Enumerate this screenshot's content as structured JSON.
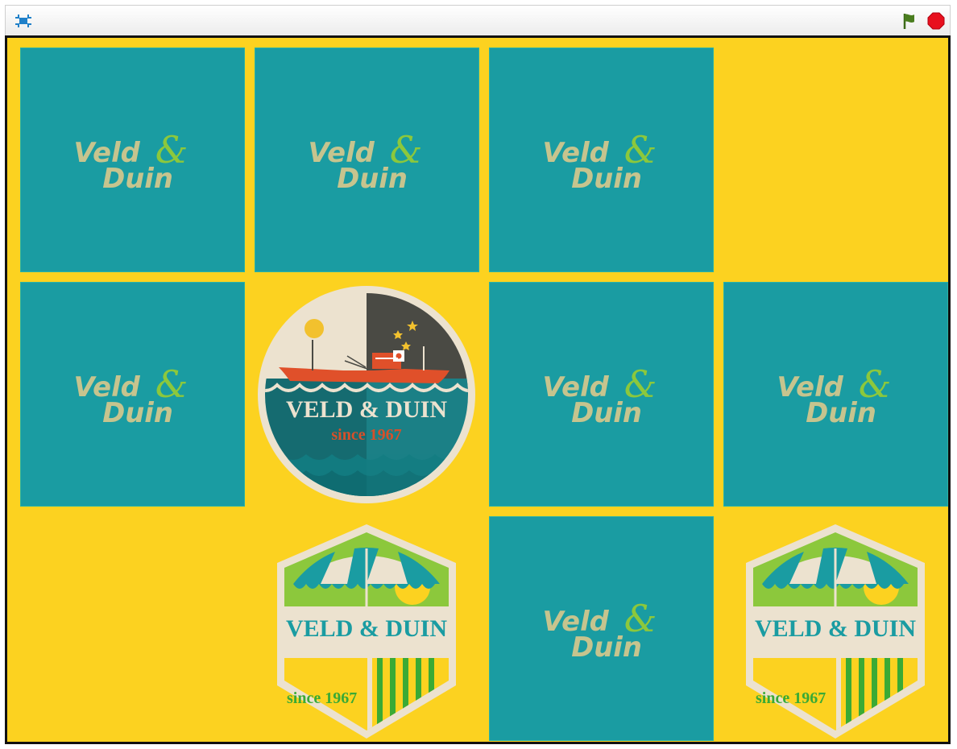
{
  "toolbar": {
    "fullscreen_icon": "fullscreen-toggle-icon",
    "green_flag_icon": "green-flag-icon",
    "stop_icon": "stop-sign-icon"
  },
  "colors": {
    "stage_bg": "#fcd220",
    "card_back": "#1a9ca2",
    "logo_text": "#c6c48e",
    "logo_amp": "#8cc83c",
    "flag": "#4a7d1f",
    "stop": "#e8101e"
  },
  "card_back_logo": {
    "word1": "Veld",
    "amp": "&",
    "word2": "Duin"
  },
  "circle_badge": {
    "title": "VELD & DUIN",
    "subtitle": "since 1967"
  },
  "umbrella_badge": {
    "title": "VELD & DUIN",
    "subtitle": "since 1967"
  },
  "board": {
    "rows": 3,
    "cols": 4,
    "cells": [
      {
        "row": 1,
        "col": 1,
        "state": "face-down"
      },
      {
        "row": 1,
        "col": 2,
        "state": "face-down"
      },
      {
        "row": 1,
        "col": 3,
        "state": "face-down"
      },
      {
        "row": 1,
        "col": 4,
        "state": "matched-removed"
      },
      {
        "row": 2,
        "col": 1,
        "state": "face-down"
      },
      {
        "row": 2,
        "col": 2,
        "state": "face-up",
        "card": "circle-badge"
      },
      {
        "row": 2,
        "col": 3,
        "state": "face-down"
      },
      {
        "row": 2,
        "col": 4,
        "state": "face-down"
      },
      {
        "row": 3,
        "col": 1,
        "state": "matched-removed"
      },
      {
        "row": 3,
        "col": 2,
        "state": "face-up",
        "card": "umbrella-badge"
      },
      {
        "row": 3,
        "col": 3,
        "state": "face-down"
      },
      {
        "row": 3,
        "col": 4,
        "state": "face-up",
        "card": "umbrella-badge"
      }
    ]
  }
}
